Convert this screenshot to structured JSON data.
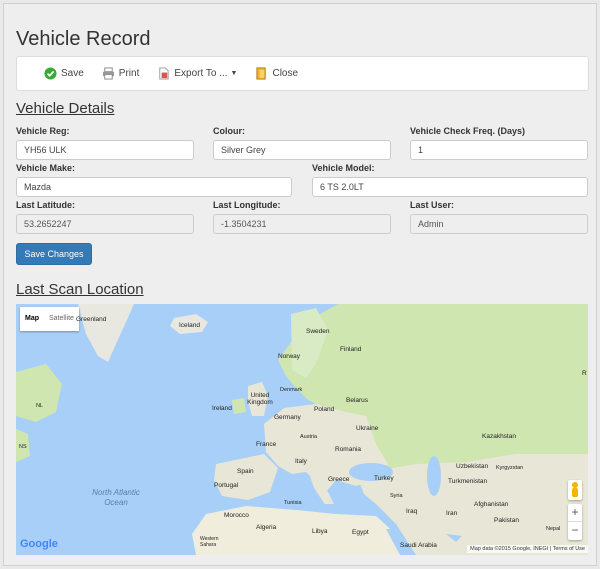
{
  "page_title": "Vehicle Record",
  "toolbar": {
    "save": "Save",
    "print": "Print",
    "export": "Export To ...",
    "close": "Close"
  },
  "vehicle_details": {
    "heading": "Vehicle Details",
    "reg": {
      "label": "Vehicle Reg:",
      "value": "YH56 ULK"
    },
    "colour": {
      "label": "Colour:",
      "value": "Silver Grey"
    },
    "check_freq": {
      "label": "Vehicle Check Freq. (Days)",
      "value": "1"
    },
    "make": {
      "label": "Vehicle Make:",
      "value": "Mazda"
    },
    "model": {
      "label": "Vehicle Model:",
      "value": "6 TS 2.0LT"
    },
    "last_latitude": {
      "label": "Last Latitude:",
      "value": "53.2652247"
    },
    "last_longitude": {
      "label": "Last Longitude:",
      "value": "-1.3504231"
    },
    "last_user": {
      "label": "Last User:",
      "value": "Admin"
    },
    "save_changes": "Save Changes"
  },
  "map_section": {
    "heading": "Last Scan Location",
    "map_type": {
      "map": "Map",
      "satellite": "Satellite"
    },
    "labels": {
      "greenland": "Greenland",
      "iceland": "Iceland",
      "sweden": "Sweden",
      "finland": "Finland",
      "norway": "Norway",
      "denmark": "Denmark",
      "united_kingdom": "United Kingdom",
      "ireland": "Ireland",
      "poland": "Poland",
      "belarus": "Belarus",
      "germany": "Germany",
      "ukraine": "Ukraine",
      "france": "France",
      "austria": "Austria",
      "romania": "Romania",
      "italy": "Italy",
      "spain": "Spain",
      "portugal": "Portugal",
      "greece": "Greece",
      "turkey": "Turkey",
      "kazakhstan": "Kazakhstan",
      "uzbekistan": "Uzbekistan",
      "kyrgyzstan": "Kyrgyzstan",
      "turkmenistan": "Turkmenistan",
      "afghanistan": "Afghanistan",
      "iran": "Iran",
      "iraq": "Iraq",
      "syria": "Syria",
      "pakistan": "Pakistan",
      "nepal": "Nepal",
      "morocco": "Morocco",
      "algeria": "Algeria",
      "tunisia": "Tunisia",
      "libya": "Libya",
      "egypt": "Egypt",
      "western_sahara": "Western Sahara",
      "saudi_arabia": "Saudi Arabia",
      "nl": "NL",
      "r": "R",
      "ns": "NS"
    },
    "ocean": "North Atlantic Ocean",
    "google": "Google",
    "attribution": "Map data ©2015 Google, INEGI",
    "terms": "Terms of Use",
    "zoom_in": "+",
    "zoom_out": "−"
  },
  "colors": {
    "primary": "#337ab7",
    "water": "#a8cff7",
    "land": "#e8e6d6",
    "land_green": "#cfe6b0"
  }
}
